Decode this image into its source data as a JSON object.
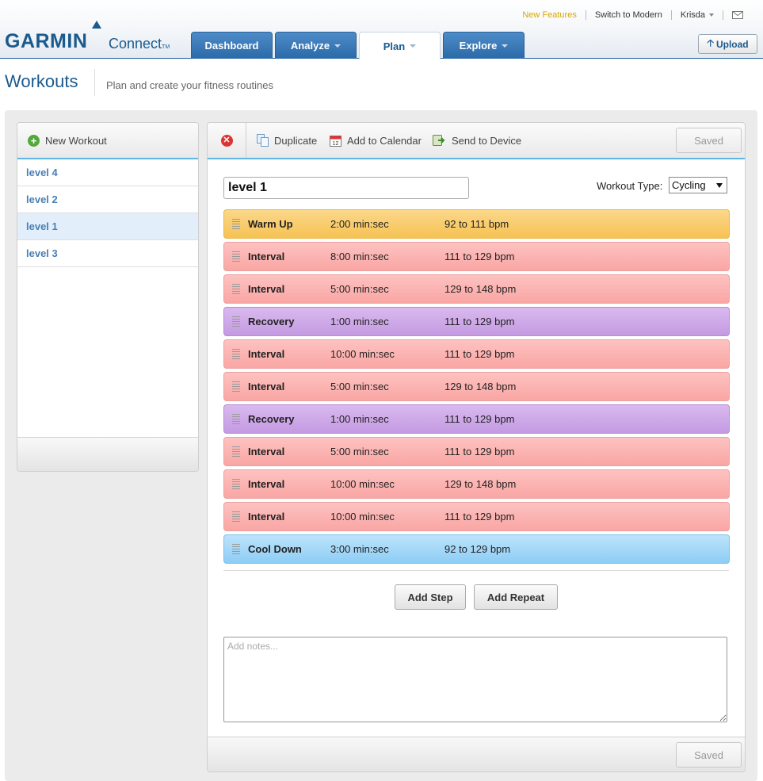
{
  "header": {
    "logo_main": "GARMIN",
    "logo_sub": "Connect",
    "logo_tm": "TM",
    "top_links": {
      "new_features": "New Features",
      "switch": "Switch to Modern",
      "user": "Krisda"
    },
    "nav": [
      {
        "label": "Dashboard",
        "has_caret": false
      },
      {
        "label": "Analyze",
        "has_caret": true
      },
      {
        "label": "Plan",
        "has_caret": true,
        "active": true
      },
      {
        "label": "Explore",
        "has_caret": true
      }
    ],
    "upload_label": "Upload"
  },
  "page": {
    "title": "Workouts",
    "subtitle": "Plan and create your fitness routines"
  },
  "sidebar": {
    "new_workout_label": "New Workout",
    "items": [
      {
        "label": "level 4"
      },
      {
        "label": "level 2"
      },
      {
        "label": "level 1",
        "active": true
      },
      {
        "label": "level 3"
      }
    ]
  },
  "toolbar": {
    "duplicate": "Duplicate",
    "add_to_calendar": "Add to Calendar",
    "send_to_device": "Send to Device",
    "saved": "Saved"
  },
  "editor": {
    "name_value": "level 1",
    "workout_type_label": "Workout Type:",
    "workout_type_value": "Cycling",
    "steps": [
      {
        "type": "warmup",
        "name": "Warm Up",
        "duration": "2:00 min:sec",
        "target": "92 to 111 bpm"
      },
      {
        "type": "interval",
        "name": "Interval",
        "duration": "8:00 min:sec",
        "target": "111 to 129 bpm"
      },
      {
        "type": "interval",
        "name": "Interval",
        "duration": "5:00 min:sec",
        "target": "129 to 148 bpm"
      },
      {
        "type": "recovery",
        "name": "Recovery",
        "duration": "1:00 min:sec",
        "target": "111 to 129 bpm"
      },
      {
        "type": "interval",
        "name": "Interval",
        "duration": "10:00 min:sec",
        "target": "111 to 129 bpm"
      },
      {
        "type": "interval",
        "name": "Interval",
        "duration": "5:00 min:sec",
        "target": "129 to 148 bpm"
      },
      {
        "type": "recovery",
        "name": "Recovery",
        "duration": "1:00 min:sec",
        "target": "111 to 129 bpm"
      },
      {
        "type": "interval",
        "name": "Interval",
        "duration": "5:00 min:sec",
        "target": "111 to 129 bpm"
      },
      {
        "type": "interval",
        "name": "Interval",
        "duration": "10:00 min:sec",
        "target": "129 to 148 bpm"
      },
      {
        "type": "interval",
        "name": "Interval",
        "duration": "10:00 min:sec",
        "target": "111 to 129 bpm"
      },
      {
        "type": "cooldown",
        "name": "Cool Down",
        "duration": "3:00 min:sec",
        "target": "92 to 129 bpm"
      }
    ],
    "add_step": "Add Step",
    "add_repeat": "Add Repeat",
    "notes_placeholder": "Add notes...",
    "notes_value": ""
  },
  "footer": {
    "saved": "Saved"
  },
  "colors": {
    "brand_blue": "#1a5a8e",
    "accent_line": "#5fb5e6",
    "warmup": "#f6c254",
    "interval": "#f9a6a4",
    "recovery": "#c49ae2",
    "cooldown": "#8dcdf5"
  }
}
